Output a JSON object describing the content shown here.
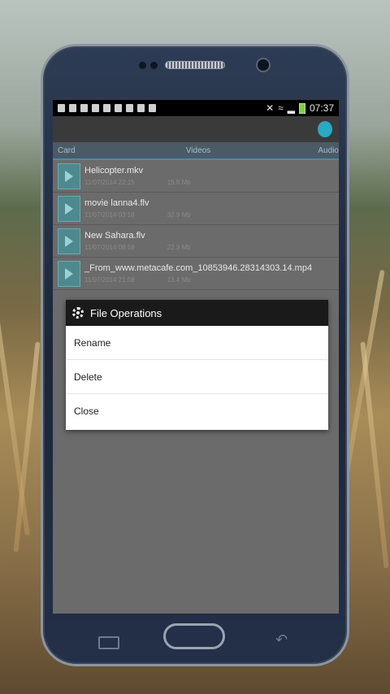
{
  "statusbar": {
    "time": "07:37"
  },
  "tabs": [
    "Card",
    "Videos",
    "Audio"
  ],
  "files": [
    {
      "name": "Helicopter.mkv",
      "date": "11/07/2014 22:15",
      "size": "15.8 Mb"
    },
    {
      "name": "movie lanna4.flv",
      "date": "11/07/2014 03:18",
      "size": "32.9 Mb"
    },
    {
      "name": "New Sahara.flv",
      "date": "11/07/2014 08:18",
      "size": "22.3 Mb"
    },
    {
      "name": "_From_www.metacafe.com_10853946.28314303.14.mp4",
      "date": "11/07/2014 21:08",
      "size": "13.4 Mb"
    }
  ],
  "dialog": {
    "title": "File Operations",
    "items": [
      "Rename",
      "Delete",
      "Close"
    ]
  }
}
